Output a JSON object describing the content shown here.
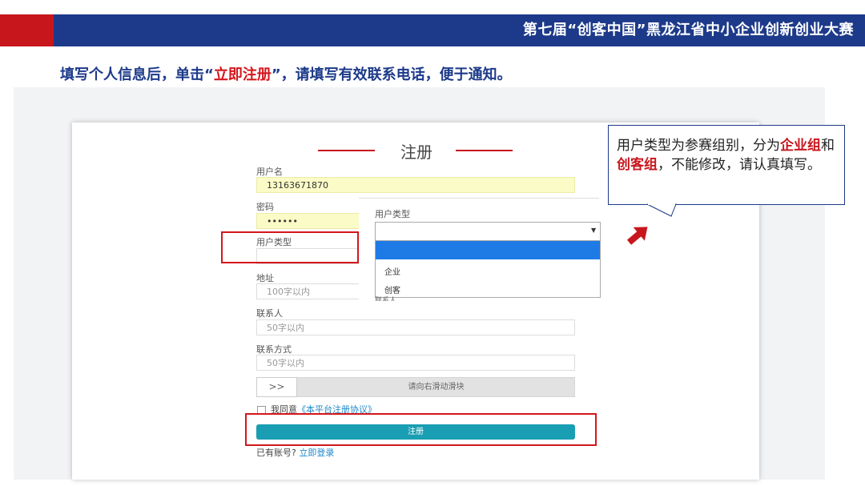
{
  "header": {
    "title": "第七届“创客中国”黑龙江省中小企业创新创业大赛"
  },
  "instruction": {
    "before": "填写个人信息后，单击“",
    "highlight": "立即注册",
    "after": "”，请填写有效联系电话，便于通知。"
  },
  "form": {
    "title": "注册",
    "username_label": "用户名",
    "username_value": "13163671870",
    "password_label": "密码",
    "password_value": "••••••",
    "usertype_label": "用户类型",
    "address_label": "地址",
    "address_placeholder": "100字以内",
    "contact_label": "联系人",
    "contact_placeholder": "50字以内",
    "phone_label": "联系方式",
    "phone_placeholder": "50字以内",
    "slider_handle": ">>",
    "slider_text": "请向右滑动滑块",
    "agree_text": "我同意",
    "agree_link": "《本平台注册协议》",
    "submit_label": "注册",
    "login_prompt": "已有账号?",
    "login_link": "立即登录",
    "hidden_label_fragment": "联系人"
  },
  "dropdown": {
    "label": "用户类型",
    "options": [
      "企业",
      "创客"
    ]
  },
  "callout": {
    "t1": "用户类型为参赛组别，分为",
    "h1": "企业组",
    "t2": "和",
    "h2": "创客组",
    "t3": "，不能修改，请认真填写。"
  },
  "colors": {
    "brand_blue": "#1d3a8a",
    "brand_red": "#c8161d",
    "submit_teal": "#1a9eb3",
    "dropdown_highlight": "#1e7be6"
  }
}
